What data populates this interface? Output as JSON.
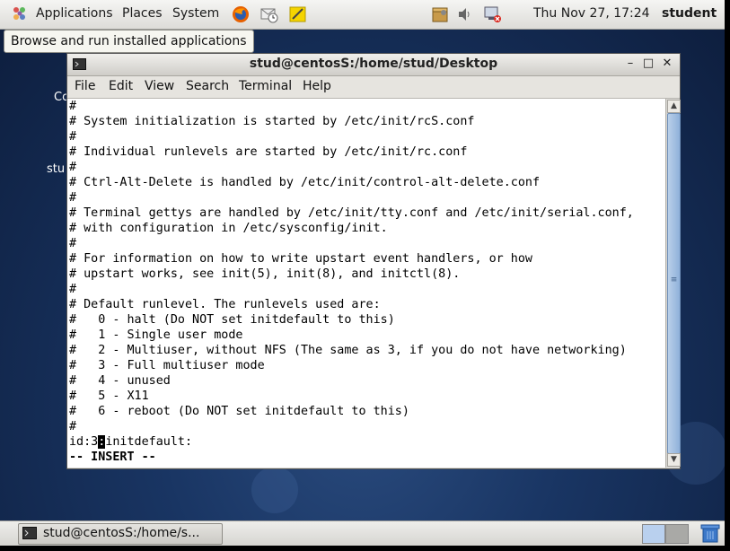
{
  "top_panel": {
    "menus": [
      "Applications",
      "Places",
      "System"
    ],
    "clock": "Thu Nov 27, 17:24",
    "user": "student"
  },
  "tooltip": "Browse and run installed applications",
  "desktop": {
    "label_fragments": [
      "Co",
      "stu"
    ]
  },
  "window": {
    "title": "stud@centosS:/home/stud/Desktop",
    "menu": [
      "File",
      "Edit",
      "View",
      "Search",
      "Terminal",
      "Help"
    ],
    "lines": [
      "#",
      "# System initialization is started by /etc/init/rcS.conf",
      "#",
      "# Individual runlevels are started by /etc/init/rc.conf",
      "#",
      "# Ctrl-Alt-Delete is handled by /etc/init/control-alt-delete.conf",
      "#",
      "# Terminal gettys are handled by /etc/init/tty.conf and /etc/init/serial.conf,",
      "# with configuration in /etc/sysconfig/init.",
      "#",
      "# For information on how to write upstart event handlers, or how",
      "# upstart works, see init(5), init(8), and initctl(8).",
      "#",
      "# Default runlevel. The runlevels used are:",
      "#   0 - halt (Do NOT set initdefault to this)",
      "#   1 - Single user mode",
      "#   2 - Multiuser, without NFS (The same as 3, if you do not have networking)",
      "#   3 - Full multiuser mode",
      "#   4 - unused",
      "#   5 - X11",
      "#   6 - reboot (Do NOT set initdefault to this)",
      "#"
    ],
    "edit_line": {
      "before": "id:3",
      "cursor_char": ":",
      "after": "initdefault:"
    },
    "status_line": "-- INSERT --"
  },
  "bottom_panel": {
    "task_label": "stud@centosS:/home/s..."
  },
  "icons": {
    "applications": "gnome-foot-icon",
    "firefox": "firefox-icon",
    "mail": "mail-clock-icon",
    "notes": "notes-icon",
    "updates": "package-updates-icon",
    "volume": "volume-icon",
    "network": "network-icon",
    "terminal": "terminal-icon",
    "trash": "trash-icon"
  }
}
